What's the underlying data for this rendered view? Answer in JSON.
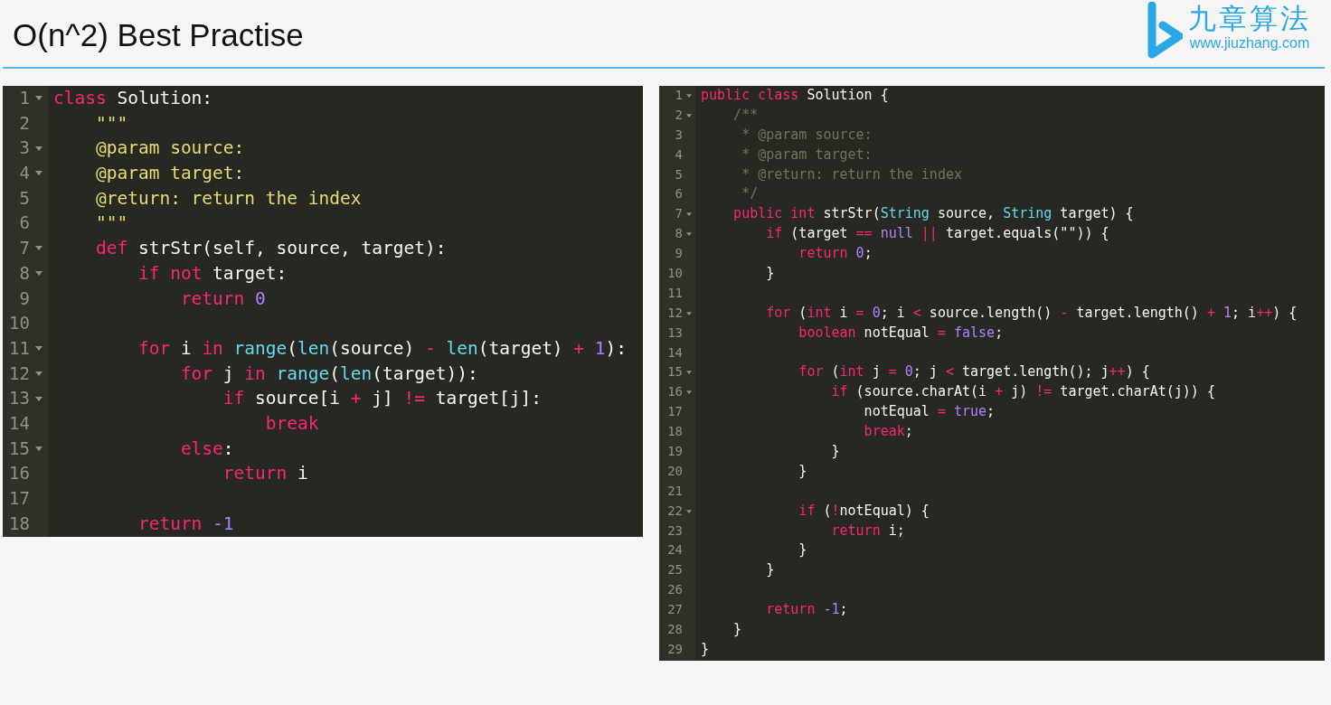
{
  "slide": {
    "title": "O(n^2) Best Practise",
    "logo": {
      "name": "九章算法",
      "url": "www.jiuzhang.com"
    }
  },
  "editors": [
    {
      "lines": [
        {
          "number": "1",
          "fold": true,
          "tokens": [
            {
              "kind": "k",
              "text": "class"
            },
            {
              "kind": "p",
              "text": " Solution:"
            }
          ]
        },
        {
          "number": "2",
          "fold": false,
          "tokens": [
            {
              "kind": "s",
              "text": "    \"\"\""
            }
          ]
        },
        {
          "number": "3",
          "fold": true,
          "tokens": [
            {
              "kind": "s",
              "text": "    @param source:"
            }
          ]
        },
        {
          "number": "4",
          "fold": true,
          "tokens": [
            {
              "kind": "s",
              "text": "    @param target:"
            }
          ]
        },
        {
          "number": "5",
          "fold": false,
          "tokens": [
            {
              "kind": "s",
              "text": "    @return: return the index"
            }
          ]
        },
        {
          "number": "6",
          "fold": false,
          "tokens": [
            {
              "kind": "s",
              "text": "    \"\"\""
            }
          ]
        },
        {
          "number": "7",
          "fold": true,
          "tokens": [
            {
              "kind": "k",
              "text": "    def"
            },
            {
              "kind": "p",
              "text": " strStr(self, source, target):"
            }
          ]
        },
        {
          "number": "8",
          "fold": true,
          "tokens": [
            {
              "kind": "k",
              "text": "        if"
            },
            {
              "kind": "k",
              "text": " not"
            },
            {
              "kind": "p",
              "text": " target:"
            }
          ]
        },
        {
          "number": "9",
          "fold": false,
          "tokens": [
            {
              "kind": "k",
              "text": "            return"
            },
            {
              "kind": "n",
              "text": " 0"
            }
          ]
        },
        {
          "number": "10",
          "fold": false
        },
        {
          "number": "11",
          "fold": true,
          "tokens": [
            {
              "kind": "k",
              "text": "        for"
            },
            {
              "kind": "p",
              "text": " i "
            },
            {
              "kind": "k",
              "text": "in"
            },
            {
              "kind": "f",
              "text": " range"
            },
            {
              "kind": "p",
              "text": "("
            },
            {
              "kind": "f",
              "text": "len"
            },
            {
              "kind": "p",
              "text": "(source) "
            },
            {
              "kind": "k",
              "text": "-"
            },
            {
              "kind": "f",
              "text": " len"
            },
            {
              "kind": "p",
              "text": "(target) "
            },
            {
              "kind": "k",
              "text": "+"
            },
            {
              "kind": "n",
              "text": " 1"
            },
            {
              "kind": "p",
              "text": "):"
            }
          ]
        },
        {
          "number": "12",
          "fold": true,
          "tokens": [
            {
              "kind": "k",
              "text": "            for"
            },
            {
              "kind": "p",
              "text": " j "
            },
            {
              "kind": "k",
              "text": "in"
            },
            {
              "kind": "f",
              "text": " range"
            },
            {
              "kind": "p",
              "text": "("
            },
            {
              "kind": "f",
              "text": "len"
            },
            {
              "kind": "p",
              "text": "(target)):"
            }
          ]
        },
        {
          "number": "13",
          "fold": true,
          "tokens": [
            {
              "kind": "k",
              "text": "                if"
            },
            {
              "kind": "p",
              "text": " source[i "
            },
            {
              "kind": "k",
              "text": "+"
            },
            {
              "kind": "p",
              "text": " j] "
            },
            {
              "kind": "k",
              "text": "!="
            },
            {
              "kind": "p",
              "text": " target[j]:"
            }
          ]
        },
        {
          "number": "14",
          "fold": false,
          "tokens": [
            {
              "kind": "k",
              "text": "                    break"
            }
          ]
        },
        {
          "number": "15",
          "fold": true,
          "tokens": [
            {
              "kind": "k",
              "text": "            else"
            },
            {
              "kind": "p",
              "text": ":"
            }
          ]
        },
        {
          "number": "16",
          "fold": false,
          "tokens": [
            {
              "kind": "k",
              "text": "                return"
            },
            {
              "kind": "p",
              "text": " i"
            }
          ]
        },
        {
          "number": "17",
          "fold": false
        },
        {
          "number": "18",
          "fold": false,
          "tokens": [
            {
              "kind": "k",
              "text": "        return"
            },
            {
              "kind": "n",
              "text": " -1"
            }
          ]
        }
      ]
    },
    {
      "lines": [
        {
          "number": "1",
          "fold": true,
          "tokens": [
            {
              "kind": "k",
              "text": "public"
            },
            {
              "kind": "k",
              "text": " class"
            },
            {
              "kind": "p",
              "text": " Solution {"
            }
          ]
        },
        {
          "number": "2",
          "fold": true,
          "tokens": [
            {
              "kind": "c",
              "text": "    /**"
            }
          ]
        },
        {
          "number": "3",
          "fold": false,
          "tokens": [
            {
              "kind": "c",
              "text": "     * @param source:"
            }
          ]
        },
        {
          "number": "4",
          "fold": false,
          "tokens": [
            {
              "kind": "c",
              "text": "     * @param target:"
            }
          ]
        },
        {
          "number": "5",
          "fold": false,
          "tokens": [
            {
              "kind": "c",
              "text": "     * @return: return the index"
            }
          ]
        },
        {
          "number": "6",
          "fold": false,
          "tokens": [
            {
              "kind": "c",
              "text": "     */"
            }
          ]
        },
        {
          "number": "7",
          "fold": true,
          "tokens": [
            {
              "kind": "k",
              "text": "    public"
            },
            {
              "kind": "k",
              "text": " int"
            },
            {
              "kind": "p",
              "text": " strStr("
            },
            {
              "kind": "f",
              "text": "String"
            },
            {
              "kind": "p",
              "text": " source, "
            },
            {
              "kind": "f",
              "text": "String"
            },
            {
              "kind": "p",
              "text": " target) {"
            }
          ]
        },
        {
          "number": "8",
          "fold": true,
          "tokens": [
            {
              "kind": "k",
              "text": "        if"
            },
            {
              "kind": "p",
              "text": " (target "
            },
            {
              "kind": "k",
              "text": "=="
            },
            {
              "kind": "n",
              "text": " null"
            },
            {
              "kind": "k",
              "text": " ||"
            },
            {
              "kind": "p",
              "text": " target.equals(\"\")) {"
            }
          ]
        },
        {
          "number": "9",
          "fold": false,
          "tokens": [
            {
              "kind": "k",
              "text": "            return"
            },
            {
              "kind": "n",
              "text": " 0"
            },
            {
              "kind": "p",
              "text": ";"
            }
          ]
        },
        {
          "number": "10",
          "fold": false,
          "tokens": [
            {
              "kind": "p",
              "text": "        }"
            }
          ]
        },
        {
          "number": "11",
          "fold": false
        },
        {
          "number": "12",
          "fold": true,
          "tokens": [
            {
              "kind": "k",
              "text": "        for"
            },
            {
              "kind": "p",
              "text": " ("
            },
            {
              "kind": "k",
              "text": "int"
            },
            {
              "kind": "p",
              "text": " i "
            },
            {
              "kind": "k",
              "text": "="
            },
            {
              "kind": "n",
              "text": " 0"
            },
            {
              "kind": "p",
              "text": "; i "
            },
            {
              "kind": "k",
              "text": "<"
            },
            {
              "kind": "p",
              "text": " source.length() "
            },
            {
              "kind": "k",
              "text": "-"
            },
            {
              "kind": "p",
              "text": " target.length() "
            },
            {
              "kind": "k",
              "text": "+"
            },
            {
              "kind": "n",
              "text": " 1"
            },
            {
              "kind": "p",
              "text": "; i"
            },
            {
              "kind": "k",
              "text": "++"
            },
            {
              "kind": "p",
              "text": ") {"
            }
          ]
        },
        {
          "number": "13",
          "fold": false,
          "tokens": [
            {
              "kind": "k",
              "text": "            boolean"
            },
            {
              "kind": "p",
              "text": " notEqual "
            },
            {
              "kind": "k",
              "text": "="
            },
            {
              "kind": "n",
              "text": " false"
            },
            {
              "kind": "p",
              "text": ";"
            }
          ]
        },
        {
          "number": "14",
          "fold": false
        },
        {
          "number": "15",
          "fold": true,
          "tokens": [
            {
              "kind": "k",
              "text": "            for"
            },
            {
              "kind": "p",
              "text": " ("
            },
            {
              "kind": "k",
              "text": "int"
            },
            {
              "kind": "p",
              "text": " j "
            },
            {
              "kind": "k",
              "text": "="
            },
            {
              "kind": "n",
              "text": " 0"
            },
            {
              "kind": "p",
              "text": "; j "
            },
            {
              "kind": "k",
              "text": "<"
            },
            {
              "kind": "p",
              "text": " target.length(); j"
            },
            {
              "kind": "k",
              "text": "++"
            },
            {
              "kind": "p",
              "text": ") {"
            }
          ]
        },
        {
          "number": "16",
          "fold": true,
          "tokens": [
            {
              "kind": "k",
              "text": "                if"
            },
            {
              "kind": "p",
              "text": " (source.charAt(i "
            },
            {
              "kind": "k",
              "text": "+"
            },
            {
              "kind": "p",
              "text": " j) "
            },
            {
              "kind": "k",
              "text": "!="
            },
            {
              "kind": "p",
              "text": " target.charAt(j)) {"
            }
          ]
        },
        {
          "number": "17",
          "fold": false,
          "tokens": [
            {
              "kind": "p",
              "text": "                    notEqual "
            },
            {
              "kind": "k",
              "text": "="
            },
            {
              "kind": "n",
              "text": " true"
            },
            {
              "kind": "p",
              "text": ";"
            }
          ]
        },
        {
          "number": "18",
          "fold": false,
          "tokens": [
            {
              "kind": "k",
              "text": "                    break"
            },
            {
              "kind": "p",
              "text": ";"
            }
          ]
        },
        {
          "number": "19",
          "fold": false,
          "tokens": [
            {
              "kind": "p",
              "text": "                }"
            }
          ]
        },
        {
          "number": "20",
          "fold": false,
          "tokens": [
            {
              "kind": "p",
              "text": "            }"
            }
          ]
        },
        {
          "number": "21",
          "fold": false
        },
        {
          "number": "22",
          "fold": true,
          "tokens": [
            {
              "kind": "k",
              "text": "            if"
            },
            {
              "kind": "p",
              "text": " ("
            },
            {
              "kind": "k",
              "text": "!"
            },
            {
              "kind": "p",
              "text": "notEqual) {"
            }
          ]
        },
        {
          "number": "23",
          "fold": false,
          "tokens": [
            {
              "kind": "k",
              "text": "                return"
            },
            {
              "kind": "p",
              "text": " i;"
            }
          ]
        },
        {
          "number": "24",
          "fold": false,
          "tokens": [
            {
              "kind": "p",
              "text": "            }"
            }
          ]
        },
        {
          "number": "25",
          "fold": false,
          "tokens": [
            {
              "kind": "p",
              "text": "        }"
            }
          ]
        },
        {
          "number": "26",
          "fold": false
        },
        {
          "number": "27",
          "fold": false,
          "tokens": [
            {
              "kind": "k",
              "text": "        return"
            },
            {
              "kind": "n",
              "text": " -1"
            },
            {
              "kind": "p",
              "text": ";"
            }
          ]
        },
        {
          "number": "28",
          "fold": false,
          "tokens": [
            {
              "kind": "p",
              "text": "    }"
            }
          ]
        },
        {
          "number": "29",
          "fold": false,
          "tokens": [
            {
              "kind": "p",
              "text": "}"
            }
          ]
        }
      ]
    }
  ]
}
